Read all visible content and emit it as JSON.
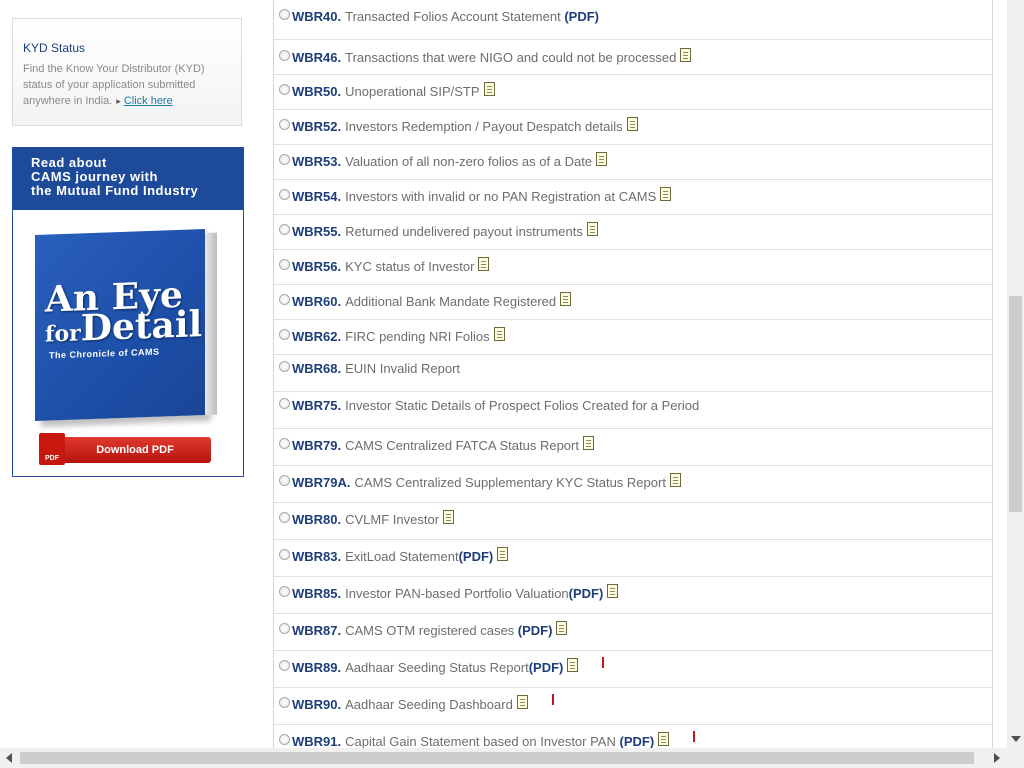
{
  "sidebar": {
    "kyd": {
      "title": "KYD Status",
      "description": "Find the Know Your Distributor (KYD) status of your application submitted anywhere in India.",
      "link_label": "Click here"
    },
    "promo": {
      "heading_line1": "Read about",
      "heading_line2": "CAMS journey with",
      "heading_line3": "the Mutual Fund Industry",
      "book_title_line1": "An Eye",
      "book_title_line2_small": "for",
      "book_title_line2": "Detail",
      "book_subtitle": "The Chronicle of CAMS",
      "download_label": "Download PDF",
      "pdf_badge": "PDF"
    }
  },
  "reports": [
    {
      "code": "WBR40.",
      "title": "Transacted Folios Account Statement",
      "pdf": " (PDF)",
      "doc": false,
      "new": false
    },
    {
      "code": "WBR46.",
      "title": "Transactions that were NIGO and could not be processed",
      "pdf": "",
      "doc": true,
      "new": false
    },
    {
      "code": "WBR50.",
      "title": "Unoperational SIP/STP",
      "pdf": "",
      "doc": true,
      "new": false
    },
    {
      "code": "WBR52.",
      "title": "Investors Redemption / Payout Despatch details",
      "pdf": "",
      "doc": true,
      "new": false
    },
    {
      "code": "WBR53.",
      "title": "Valuation of all non-zero folios as of a Date",
      "pdf": "",
      "doc": true,
      "new": false
    },
    {
      "code": "WBR54.",
      "title": "Investors with invalid or no PAN Registration at CAMS",
      "pdf": "",
      "doc": true,
      "new": false
    },
    {
      "code": "WBR55.",
      "title": "Returned undelivered payout instruments",
      "pdf": "",
      "doc": true,
      "new": false
    },
    {
      "code": "WBR56.",
      "title": "KYC status of Investor",
      "pdf": "",
      "doc": true,
      "new": false
    },
    {
      "code": "WBR60.",
      "title": "Additional Bank Mandate Registered",
      "pdf": "",
      "doc": true,
      "new": false
    },
    {
      "code": "WBR62.",
      "title": "FIRC pending NRI Folios",
      "pdf": "",
      "doc": true,
      "new": false
    },
    {
      "code": "WBR68.",
      "title": "EUIN Invalid Report",
      "pdf": "",
      "doc": false,
      "new": false
    },
    {
      "code": "WBR75.",
      "title": "Investor Static Details of Prospect Folios Created for a Period",
      "pdf": "",
      "doc": false,
      "new": false
    },
    {
      "code": "WBR79.",
      "title": "CAMS Centralized FATCA Status Report",
      "pdf": "",
      "doc": true,
      "new": false
    },
    {
      "code": "WBR79A.",
      "title": "CAMS Centralized Supplementary KYC Status Report",
      "pdf": "",
      "doc": true,
      "new": false
    },
    {
      "code": "WBR80.",
      "title": "CVLMF Investor",
      "pdf": "",
      "doc": true,
      "new": false
    },
    {
      "code": "WBR83.",
      "title": "ExitLoad Statement",
      "pdf": "(PDF)",
      "doc": true,
      "new": false
    },
    {
      "code": "WBR85.",
      "title": "Investor PAN-based Portfolio Valuation",
      "pdf": "(PDF)",
      "doc": true,
      "new": false
    },
    {
      "code": "WBR87.",
      "title": "CAMS OTM registered cases",
      "pdf": " (PDF)",
      "doc": true,
      "new": false
    },
    {
      "code": "WBR89.",
      "title": "Aadhaar Seeding Status Report",
      "pdf": "(PDF)",
      "doc": true,
      "new": true
    },
    {
      "code": "WBR90.",
      "title": "Aadhaar Seeding Dashboard",
      "pdf": "",
      "doc": true,
      "new": true
    },
    {
      "code": "WBR91.",
      "title": "Capital Gain Statement based on Investor PAN",
      "pdf": " (PDF)",
      "doc": true,
      "new": true
    }
  ]
}
